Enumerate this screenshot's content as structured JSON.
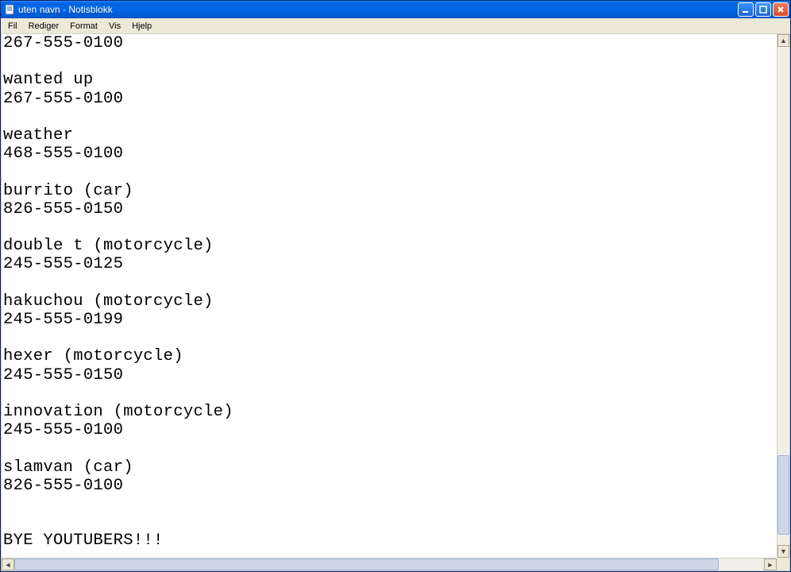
{
  "window": {
    "title": "uten navn - Notisblokk"
  },
  "menu": {
    "file": "Fil",
    "edit": "Rediger",
    "format": "Format",
    "view": "Vis",
    "help": "Hjelp"
  },
  "textarea": {
    "content": "267-555-0100\n\nwanted up\n267-555-0100\n\nweather\n468-555-0100\n\nburrito (car)\n826-555-0150\n\ndouble t (motorcycle)\n245-555-0125\n\nhakuchou (motorcycle)\n245-555-0199\n\nhexer (motorcycle)\n245-555-0150\n\ninnovation (motorcycle)\n245-555-0100\n\nslamvan (car)\n826-555-0100\n\n\nBYE YOUTUBERS!!!"
  },
  "scroll": {
    "v_thumb_top_pct": 82,
    "v_thumb_height_pct": 16,
    "h_thumb_left_pct": 0,
    "h_thumb_width_pct": 94
  }
}
